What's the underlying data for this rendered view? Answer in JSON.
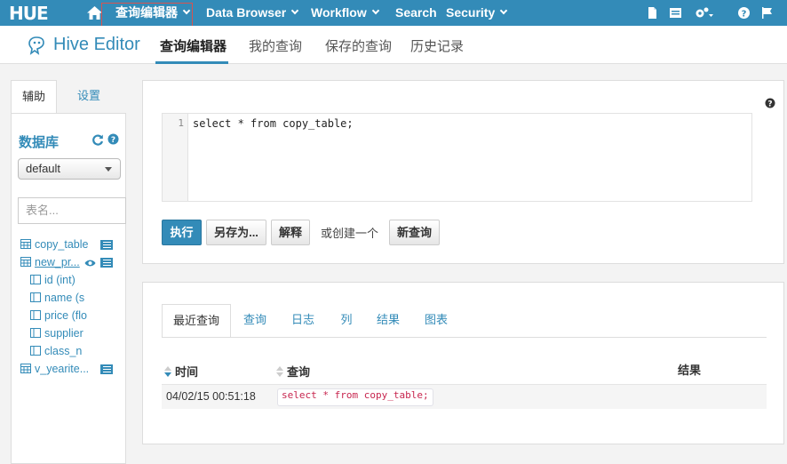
{
  "topnav": {
    "logo": "HUE",
    "query_editors": "查询编辑器",
    "data_browser": "Data Browser",
    "workflow": "Workflow",
    "search": "Search",
    "security": "Security"
  },
  "subnav": {
    "app_title": "Hive Editor",
    "tabs": [
      "查询编辑器",
      "我的查询",
      "保存的查询",
      "历史记录"
    ]
  },
  "sidebar": {
    "tabs": [
      "辅助",
      "设置"
    ],
    "db_title": "数据库",
    "db_selected": "default",
    "table_placeholder": "表名...",
    "tables": [
      "copy_table",
      "new_pr...",
      "v_yearite..."
    ],
    "columns": [
      "id (int)",
      "name (s",
      "price (flo",
      "supplier",
      "class_n"
    ]
  },
  "editor": {
    "line_number": "1",
    "code": "select * from copy_table;",
    "buttons": {
      "execute": "执行",
      "save_as": "另存为...",
      "explain": "解释",
      "or_create": "或创建一个",
      "new_query": "新查询"
    }
  },
  "results": {
    "tabs": [
      "最近查询",
      "查询",
      "日志",
      "列",
      "结果",
      "图表"
    ],
    "headers": {
      "time": "时间",
      "query": "查询",
      "result": "结果"
    },
    "rows": [
      {
        "time": "04/02/15 00:51:18",
        "query": "select * from copy_table;"
      }
    ]
  },
  "colors": {
    "brand": "#338bb8",
    "highlight_box": "#d9534f",
    "code_keyword": "#c7254e"
  }
}
